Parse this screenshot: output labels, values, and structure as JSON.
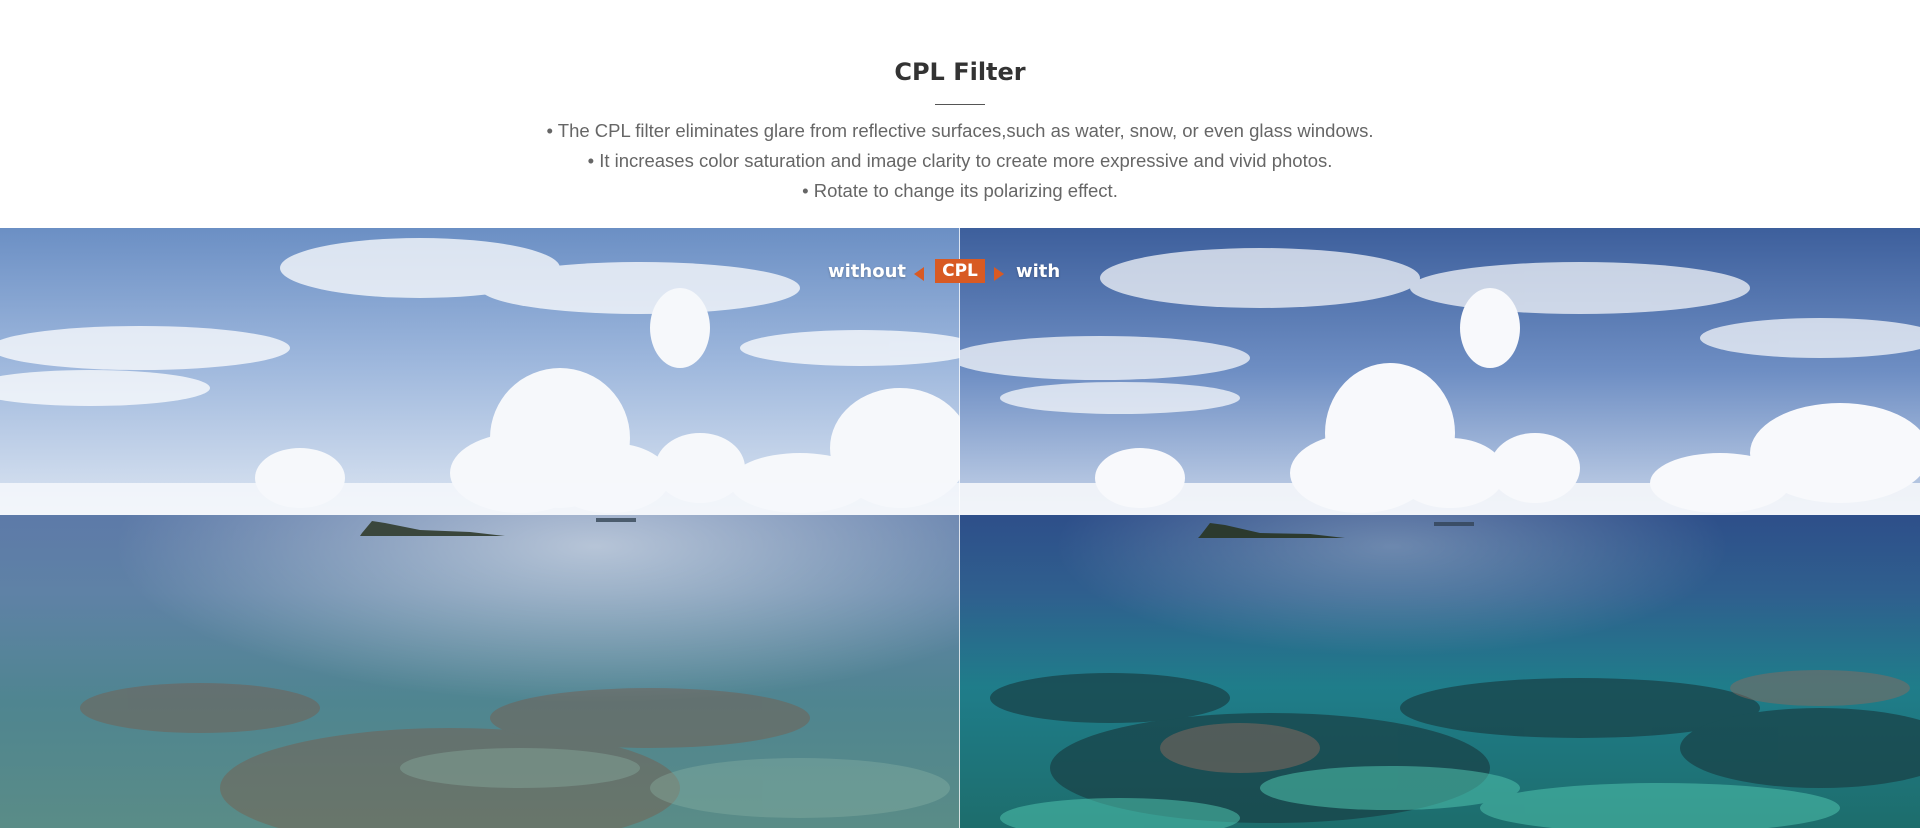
{
  "header": {
    "title": "CPL Filter",
    "bullets": [
      "• The CPL filter eliminates glare from reflective surfaces,such as water, snow, or even glass windows.",
      "• It increases color saturation and image clarity to create more expressive and vivid photos.",
      "• Rotate to change its polarizing effect."
    ]
  },
  "comparison": {
    "without_label": "without",
    "with_label": "with",
    "badge_label": "CPL",
    "accent_color": "#d85a23",
    "left_image": "seascape-without-cpl",
    "right_image": "seascape-with-cpl"
  }
}
